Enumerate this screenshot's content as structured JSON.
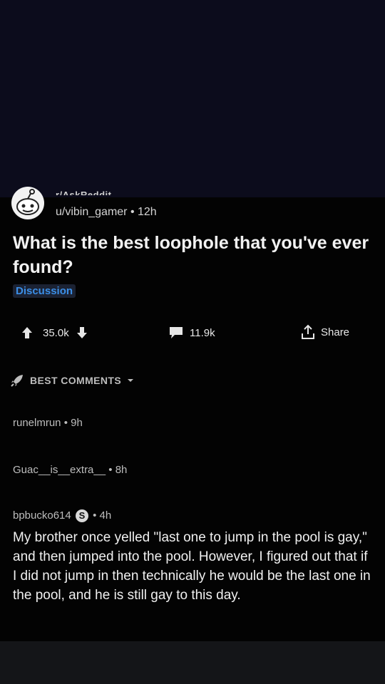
{
  "post": {
    "subreddit": "r/AskReddit",
    "author": "u/vibin_gamer",
    "age": "12h",
    "title": "What is the best loophole that you've ever found?",
    "flair": "Discussion"
  },
  "actions": {
    "upvotes": "35.0k",
    "comments": "11.9k",
    "share_label": "Share"
  },
  "comments_section": {
    "sort_label": "BEST COMMENTS"
  },
  "comments": [
    {
      "author": "runelmrun",
      "age": "9h"
    },
    {
      "author": "Guac__is__extra__",
      "age": "8h"
    },
    {
      "author": "bpbucko614",
      "badge": "S",
      "age": "4h",
      "body": "My brother once yelled \"last one to jump in the pool is gay,\" and then jumped into the pool. However, I figured out that if I did not jump in then technically he would be the last one in the pool, and he is still gay to this day."
    }
  ],
  "colors": {
    "background": "#030303",
    "flair_text": "#3b8ee6",
    "flair_bg": "#1b2233",
    "top_band": "#0c0c1c"
  }
}
